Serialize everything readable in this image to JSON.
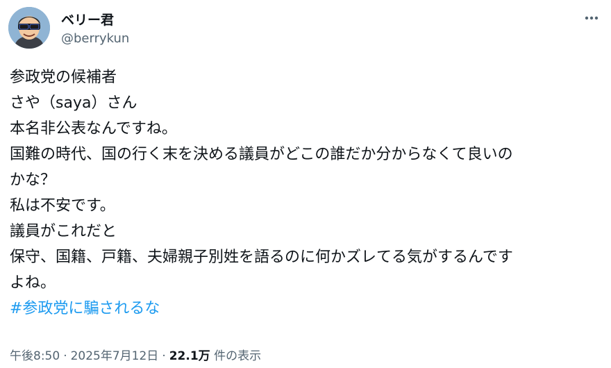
{
  "user": {
    "display_name": "ベリー君",
    "handle": "@berrykun",
    "avatar_icon": "avatar-cartoon-sunglasses"
  },
  "more_icon": "more-dots-icon",
  "tweet": {
    "lines": [
      "参政党の候補者",
      "さや（saya）さん",
      "本名非公表なんですね。",
      "国難の時代、国の行く末を決める議員がどこの誰だか分からなくて良いの",
      "かな？",
      "私は不安です。",
      "議員がこれだと",
      "保守、国籍、戸籍、夫婦親子別姓を語るのに何かズレてる気がするんです",
      "よね。"
    ],
    "hashtag": "#参政党に騙されるな"
  },
  "meta": {
    "time": "午後8:50",
    "separator": "·",
    "date": "2025年7月12日",
    "views_count": "22.1万",
    "views_label": "件の表示"
  },
  "colors": {
    "text": "#0f1419",
    "secondary": "#536471",
    "link": "#1d9bf0"
  }
}
